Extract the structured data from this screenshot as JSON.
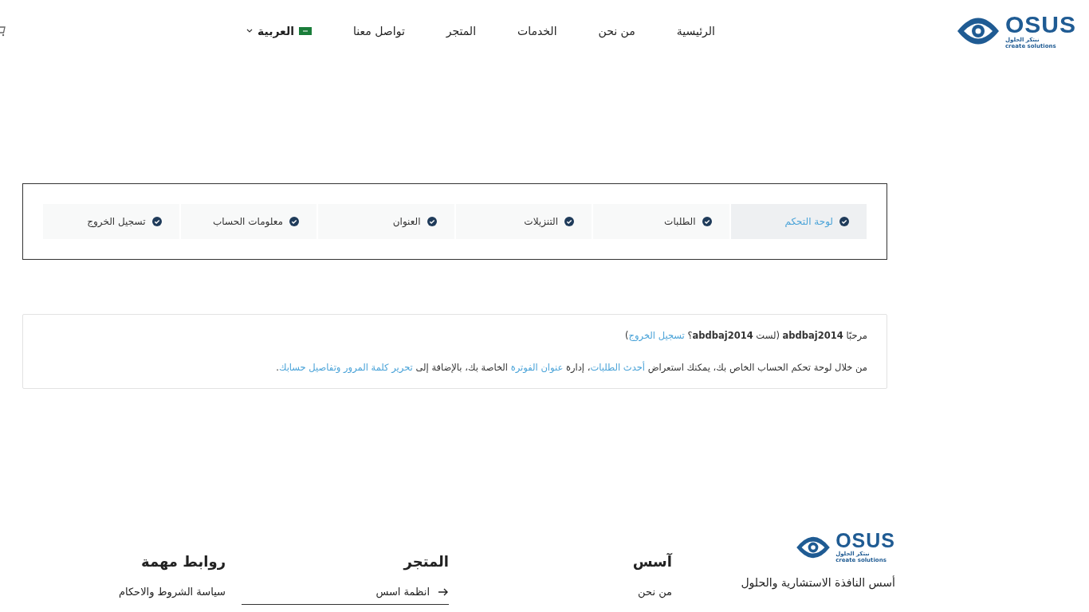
{
  "header": {
    "logo": {
      "name": "OSUS",
      "tagline": "نبتكر الحلول",
      "slogan": "create solutions"
    },
    "nav": [
      {
        "label": "الرئيسية"
      },
      {
        "label": "من نحن"
      },
      {
        "label": "الخدمات"
      },
      {
        "label": "المتجر"
      },
      {
        "label": "تواصل معنا"
      }
    ],
    "language": {
      "label": "العربية"
    }
  },
  "account_tabs": [
    {
      "label": "لوحة التحكم",
      "selected": true
    },
    {
      "label": "الطلبات",
      "selected": false
    },
    {
      "label": "التنزيلات",
      "selected": false
    },
    {
      "label": "العنوان",
      "selected": false
    },
    {
      "label": "معلومات الحساب",
      "selected": false
    },
    {
      "label": "تسجيل الخروج",
      "selected": false
    }
  ],
  "welcome": {
    "lines": [
      [
        {
          "kind": "text",
          "text": "مرحبًا **abdbaj2014** (لست **abdbaj2014**؟ "
        },
        {
          "kind": "link",
          "text": "تسجيل الخروج"
        },
        {
          "kind": "text",
          "text": ")"
        }
      ],
      [
        {
          "kind": "text",
          "text": "من خلال لوحة تحكم الحساب الخاص بك، يمكنك استعراض "
        },
        {
          "kind": "link",
          "text": "أحدث الطلبات"
        },
        {
          "kind": "text",
          "text": "، إدارة "
        },
        {
          "kind": "link",
          "text": "عنوان الفوترة"
        },
        {
          "kind": "text",
          "text": " الخاصة بك، بالإضافة إلى "
        },
        {
          "kind": "link",
          "text": "تحرير كلمة المرور وتفاصيل حسابك"
        },
        {
          "kind": "text",
          "text": "."
        }
      ]
    ]
  },
  "footer": {
    "logo": {
      "name": "OSUS",
      "tagline": "نبتكر الحلول",
      "slogan": "create solutions"
    },
    "about": "أسس النافذة الاستشارية والحلول",
    "columns": [
      {
        "title": "آسس",
        "links": [
          {
            "label": "من نحن",
            "arrow": false
          }
        ]
      },
      {
        "title": "المتجر",
        "links": [
          {
            "label": "انظمة اسس",
            "arrow": true
          }
        ]
      },
      {
        "title": "روابط مهمة",
        "links": [
          {
            "label": "سياسة الشروط والاحكام",
            "arrow": false
          }
        ]
      }
    ]
  }
}
